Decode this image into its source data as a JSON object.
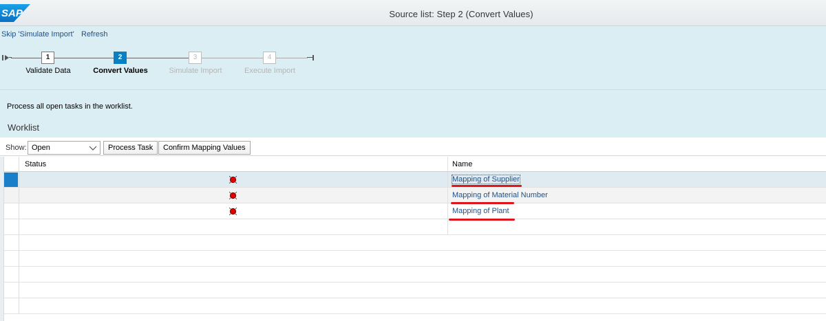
{
  "header": {
    "logo_text": "SAP",
    "title": "Source list: Step 2  (Convert Values)"
  },
  "toolbar": {
    "skip_label": "Skip 'Simulate Import'",
    "refresh_label": "Refresh"
  },
  "roadmap": {
    "steps": [
      {
        "number": "1",
        "label": "Validate Data",
        "state": "done"
      },
      {
        "number": "2",
        "label": "Convert Values",
        "state": "active"
      },
      {
        "number": "3",
        "label": "Simulate Import",
        "state": "disabled"
      },
      {
        "number": "4",
        "label": "Execute Import",
        "state": "disabled"
      }
    ]
  },
  "info": {
    "instruction": "Process all open tasks in the worklist.",
    "worklist_title": "Worklist"
  },
  "filter": {
    "show_label": "Show:",
    "selected": "Open",
    "process_task_label": "Process Task",
    "confirm_mapping_label": "Confirm Mapping Values"
  },
  "table": {
    "columns": [
      "Status",
      "Name"
    ],
    "rows": [
      {
        "status": "red",
        "name": "Mapping of Supplier"
      },
      {
        "status": "red",
        "name": "Mapping of Material Number"
      },
      {
        "status": "red",
        "name": "Mapping of Plant"
      }
    ]
  },
  "colors": {
    "accent": "#0a7fc2",
    "link": "#1f4f87",
    "background": "#dbeef3",
    "status_error": "#e00000",
    "annotation": "#e0151b"
  }
}
